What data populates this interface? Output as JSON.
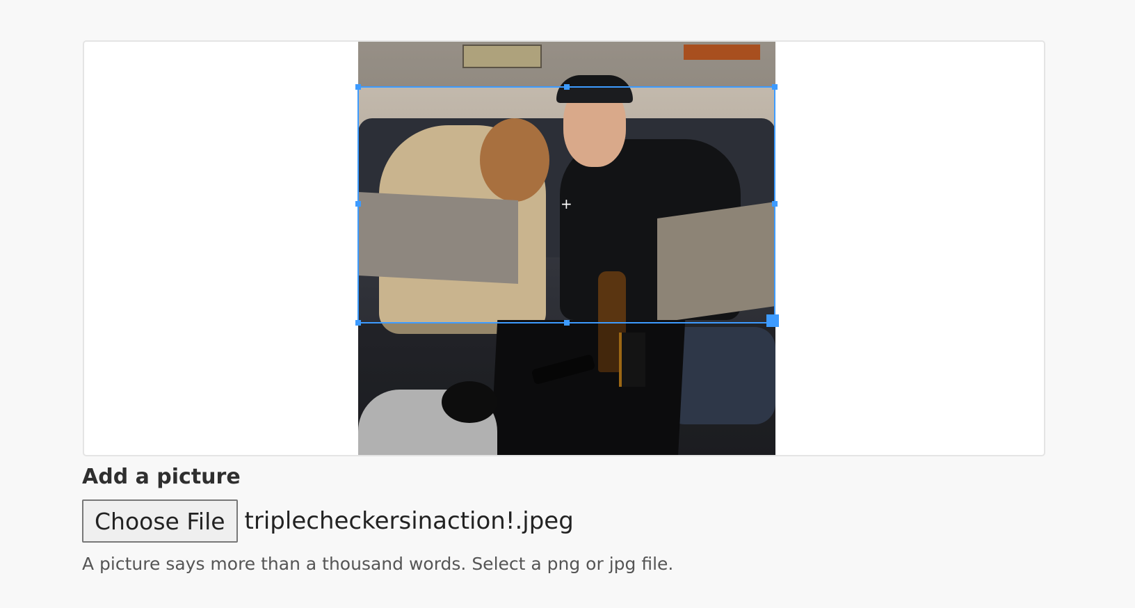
{
  "cropper": {
    "crop_center_glyph": "+"
  },
  "form": {
    "label": "Add a picture",
    "choose_button": "Choose File",
    "file_name": "triplecheckersinaction!.jpeg",
    "help_text": "A picture says more than a thousand words. Select a png or jpg file."
  },
  "colors": {
    "crop_accent": "#3d9bff",
    "background": "#f8f8f8"
  }
}
